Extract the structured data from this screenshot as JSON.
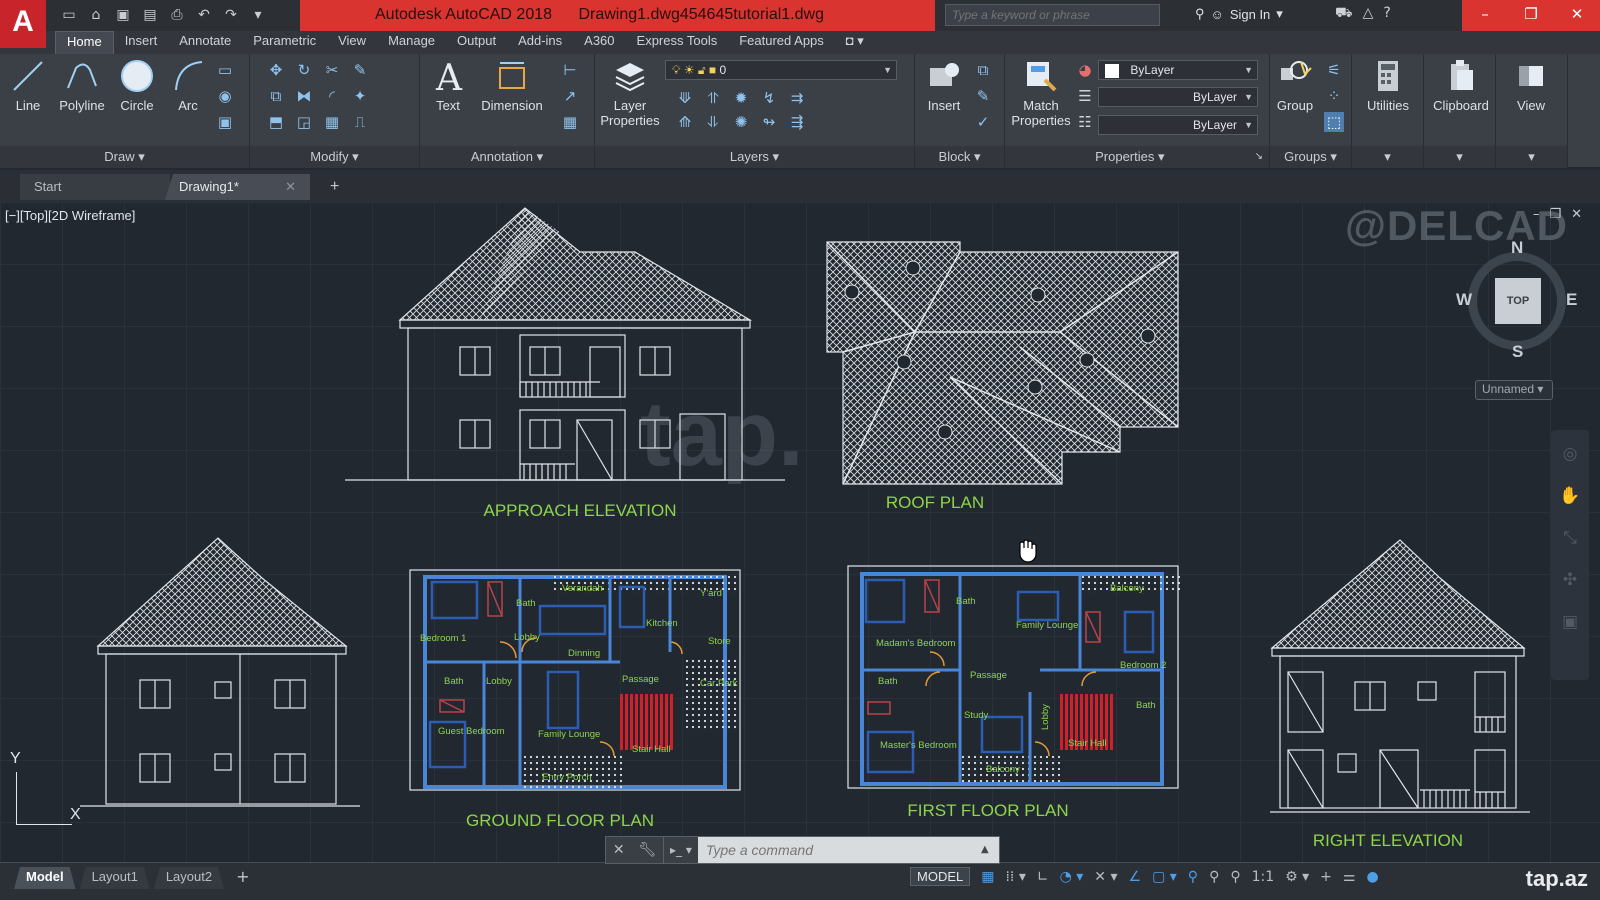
{
  "app": {
    "logo": "A",
    "title": "Autodesk AutoCAD 2018",
    "file": "Drawing1.dwg454645tutorial1.dwg",
    "search_placeholder": "Type a keyword or phrase",
    "signin": "Sign In",
    "accent_color": "#d9342f"
  },
  "ribbon_tabs": [
    "Home",
    "Insert",
    "Annotate",
    "Parametric",
    "View",
    "Manage",
    "Output",
    "Add-ins",
    "A360",
    "Express Tools",
    "Featured Apps"
  ],
  "ribbon": {
    "draw": {
      "title": "Draw",
      "line": "Line",
      "polyline": "Polyline",
      "circle": "Circle",
      "arc": "Arc"
    },
    "modify": {
      "title": "Modify"
    },
    "annotation": {
      "title": "Annotation",
      "text": "Text",
      "dimension": "Dimension"
    },
    "layers": {
      "title": "Layers",
      "layer_properties_1": "Layer",
      "layer_properties_2": "Properties",
      "current_layer": "0"
    },
    "block": {
      "title": "Block",
      "insert": "Insert"
    },
    "properties": {
      "title": "Properties",
      "match_1": "Match",
      "match_2": "Properties",
      "color": "ByLayer",
      "linetype": "ByLayer",
      "lineweight": "ByLayer"
    },
    "groups": {
      "title": "Groups",
      "group": "Group"
    },
    "utilities": "Utilities",
    "clipboard": "Clipboard",
    "view": "View"
  },
  "file_tabs": {
    "start": "Start",
    "drawing": "Drawing1*"
  },
  "viewport": {
    "label": "[−][Top][2D Wireframe]",
    "watermark": "@DELCAD",
    "watermark2": "tap.",
    "viewcube": {
      "top": "TOP",
      "n": "N",
      "s": "S",
      "e": "E",
      "w": "W"
    },
    "ucs_name": "Unnamed",
    "ucs_x": "X",
    "ucs_y": "Y"
  },
  "drawing_labels": {
    "approach": "APPROACH ELEVATION",
    "roof": "ROOF PLAN",
    "ground": "GROUND FLOOR PLAN",
    "first": "FIRST FLOOR PLAN",
    "right": "RIGHT ELEVATION"
  },
  "ground_rooms": [
    "Bedroom 1",
    "Bath",
    "Lobby",
    "Verandah",
    "Kitchen",
    "Store",
    "Dinning",
    "Bath",
    "Lobby",
    "Passage",
    "Car Park",
    "Guest Bedroom",
    "Family Lounge",
    "Stair Hall",
    "Entry Porch",
    "Y'ard"
  ],
  "first_rooms": [
    "Madam's Bedroom",
    "Bath",
    "Family Lounge",
    "Balcony",
    "Bedroom 2",
    "Bath",
    "Passage",
    "Master's Bedroom",
    "Study",
    "Stair Hall",
    "Bath",
    "Balcony",
    "Lobby"
  ],
  "command": {
    "placeholder": "Type a command"
  },
  "status": {
    "model_tab": "Model",
    "layout1": "Layout1",
    "layout2": "Layout2",
    "model": "MODEL",
    "scale": "1:1"
  },
  "corner_watermark": "tap.az"
}
